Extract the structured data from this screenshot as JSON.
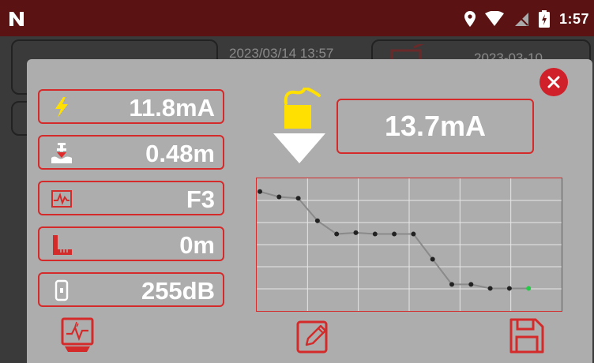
{
  "status_bar": {
    "time": "1:57",
    "icons": [
      "n-logo-icon",
      "location-icon",
      "wifi-icon",
      "no-sim-icon",
      "battery-charging-icon"
    ]
  },
  "background": {
    "datetime": "2023/03/14 13:57",
    "date": "2023-03-10"
  },
  "dialog": {
    "readings": [
      {
        "icon": "lightning-icon",
        "value": "11.8mA"
      },
      {
        "icon": "depth-icon",
        "value": "0.48m"
      },
      {
        "icon": "waveform-icon",
        "value": "F3"
      },
      {
        "icon": "ruler-icon",
        "value": "0m"
      },
      {
        "icon": "signal-phone-icon",
        "value": "255dB"
      }
    ],
    "main_reading": "13.7mA",
    "graph": {
      "points": [
        0.9,
        0.86,
        0.85,
        0.68,
        0.58,
        0.59,
        0.58,
        0.58,
        0.58,
        0.39,
        0.2,
        0.2,
        0.17,
        0.17,
        0.17
      ],
      "last_point_color": "#22cc44",
      "point_color": "#222222",
      "line_color": "#8a8a8a"
    },
    "toolbar": [
      "waveform-screen-icon",
      "edit-icon",
      "save-icon"
    ]
  },
  "colors": {
    "accent": "#d42a2a",
    "dialog_bg": "#adadad",
    "status_bar": "#5a1212",
    "lightning": "#ffe000"
  }
}
